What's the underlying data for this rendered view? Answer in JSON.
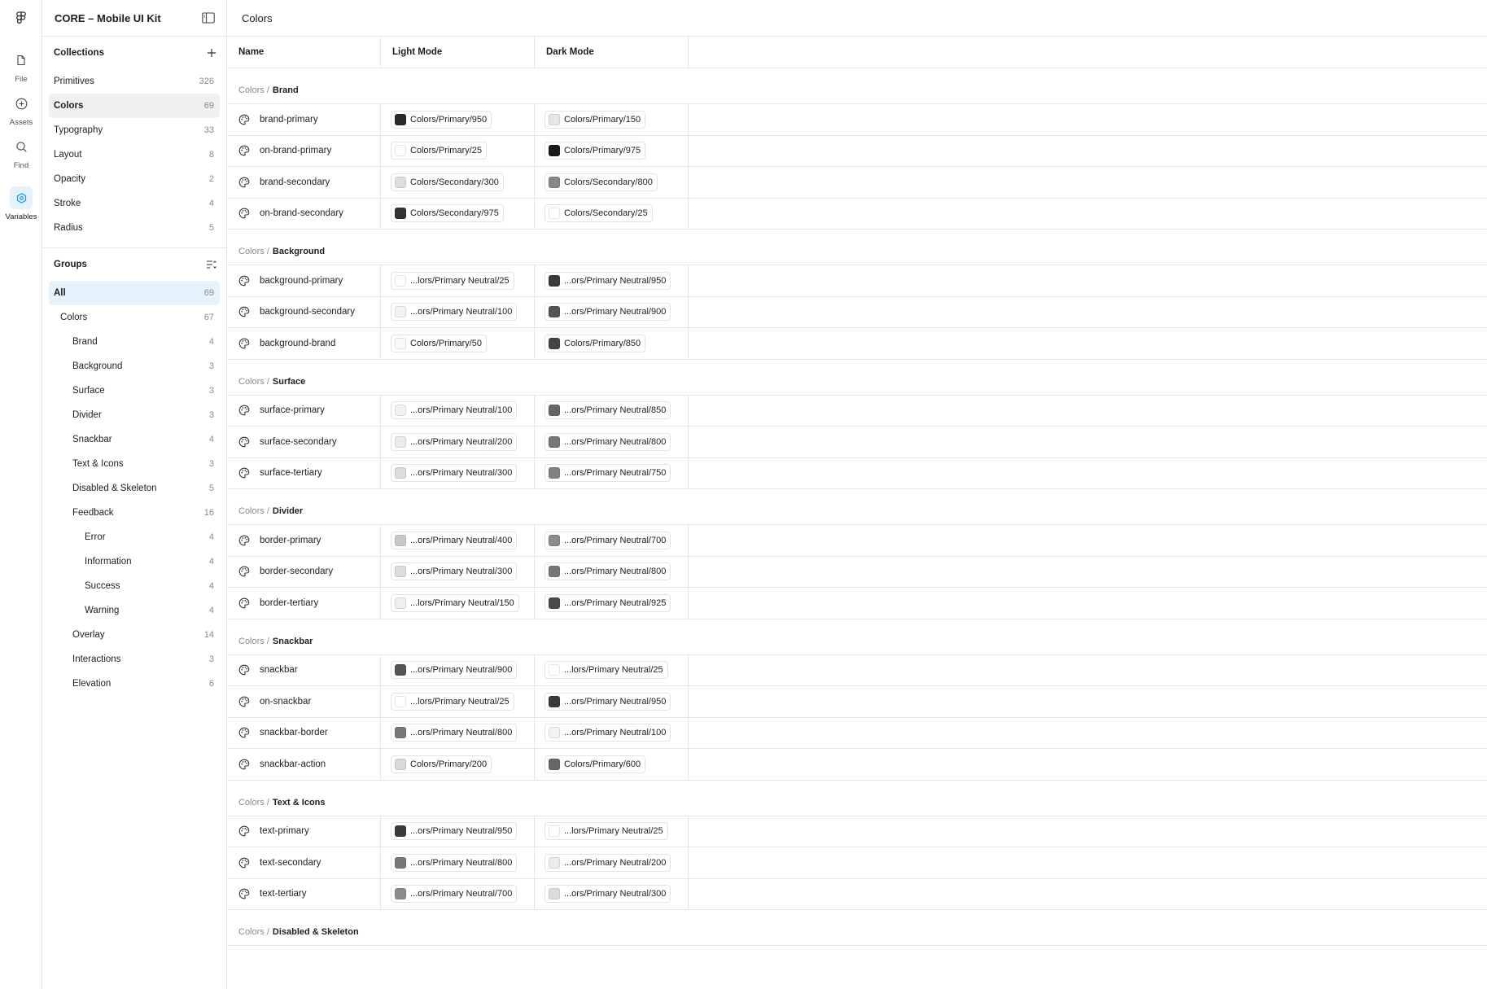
{
  "app": {
    "file_title": "CORE – Mobile UI Kit",
    "page_title": "Colors"
  },
  "rail": [
    {
      "label": "File",
      "icon": "file-icon"
    },
    {
      "label": "Assets",
      "icon": "plus-circle-icon"
    },
    {
      "label": "Find",
      "icon": "search-icon"
    },
    {
      "label": "Variables",
      "icon": "variables-icon"
    }
  ],
  "collections": {
    "title": "Collections",
    "items": [
      {
        "label": "Primitives",
        "count": "326"
      },
      {
        "label": "Colors",
        "count": "69"
      },
      {
        "label": "Typography",
        "count": "33"
      },
      {
        "label": "Layout",
        "count": "8"
      },
      {
        "label": "Opacity",
        "count": "2"
      },
      {
        "label": "Stroke",
        "count": "4"
      },
      {
        "label": "Radius",
        "count": "5"
      }
    ]
  },
  "groups": {
    "title": "Groups",
    "items": [
      {
        "label": "All",
        "count": "69"
      },
      {
        "label": "Colors",
        "count": "67"
      },
      {
        "label": "Brand",
        "count": "4"
      },
      {
        "label": "Background",
        "count": "3"
      },
      {
        "label": "Surface",
        "count": "3"
      },
      {
        "label": "Divider",
        "count": "3"
      },
      {
        "label": "Snackbar",
        "count": "4"
      },
      {
        "label": "Text & Icons",
        "count": "3"
      },
      {
        "label": "Disabled & Skeleton",
        "count": "5"
      },
      {
        "label": "Feedback",
        "count": "16"
      },
      {
        "label": "Error",
        "count": "4"
      },
      {
        "label": "Information",
        "count": "4"
      },
      {
        "label": "Success",
        "count": "4"
      },
      {
        "label": "Warning",
        "count": "4"
      },
      {
        "label": "Overlay",
        "count": "14"
      },
      {
        "label": "Interactions",
        "count": "3"
      },
      {
        "label": "Elevation",
        "count": "6"
      }
    ]
  },
  "table": {
    "headers": {
      "name": "Name",
      "light": "Light Mode",
      "dark": "Dark Mode"
    },
    "prefix": "Colors /",
    "sections": [
      {
        "group": "Brand",
        "rows": [
          {
            "name": "brand-primary",
            "light": "Colors/Primary/950",
            "light_color": "#2a2a2a",
            "dark": "Colors/Primary/150",
            "dark_color": "#e6e6e6"
          },
          {
            "name": "on-brand-primary",
            "light": "Colors/Primary/25",
            "light_color": "#ffffff",
            "dark": "Colors/Primary/975",
            "dark_color": "#1a1a1a"
          },
          {
            "name": "brand-secondary",
            "light": "Colors/Secondary/300",
            "light_color": "#dedede",
            "dark": "Colors/Secondary/800",
            "dark_color": "#888888"
          },
          {
            "name": "on-brand-secondary",
            "light": "Colors/Secondary/975",
            "light_color": "#333333",
            "dark": "Colors/Secondary/25",
            "dark_color": "#ffffff"
          }
        ]
      },
      {
        "group": "Background",
        "rows": [
          {
            "name": "background-primary",
            "light": "...lors/Primary Neutral/25",
            "light_color": "#ffffff",
            "dark": "...ors/Primary Neutral/950",
            "dark_color": "#3a3a3a"
          },
          {
            "name": "background-secondary",
            "light": "...ors/Primary Neutral/100",
            "light_color": "#f2f2f2",
            "dark": "...ors/Primary Neutral/900",
            "dark_color": "#555555"
          },
          {
            "name": "background-brand",
            "light": "Colors/Primary/50",
            "light_color": "#fafafa",
            "dark": "Colors/Primary/850",
            "dark_color": "#444444"
          }
        ]
      },
      {
        "group": "Surface",
        "rows": [
          {
            "name": "surface-primary",
            "light": "...ors/Primary Neutral/100",
            "light_color": "#f2f2f2",
            "dark": "...ors/Primary Neutral/850",
            "dark_color": "#666666"
          },
          {
            "name": "surface-secondary",
            "light": "...ors/Primary Neutral/200",
            "light_color": "#ebebeb",
            "dark": "...ors/Primary Neutral/800",
            "dark_color": "#777777"
          },
          {
            "name": "surface-tertiary",
            "light": "...ors/Primary Neutral/300",
            "light_color": "#dcdcdc",
            "dark": "...ors/Primary Neutral/750",
            "dark_color": "#828282"
          }
        ]
      },
      {
        "group": "Divider",
        "rows": [
          {
            "name": "border-primary",
            "light": "...ors/Primary Neutral/400",
            "light_color": "#c8c8c8",
            "dark": "...ors/Primary Neutral/700",
            "dark_color": "#8c8c8c"
          },
          {
            "name": "border-secondary",
            "light": "...ors/Primary Neutral/300",
            "light_color": "#dcdcdc",
            "dark": "...ors/Primary Neutral/800",
            "dark_color": "#777777"
          },
          {
            "name": "border-tertiary",
            "light": "...lors/Primary Neutral/150",
            "light_color": "#efefef",
            "dark": "...ors/Primary Neutral/925",
            "dark_color": "#4a4a4a"
          }
        ]
      },
      {
        "group": "Snackbar",
        "rows": [
          {
            "name": "snackbar",
            "light": "...ors/Primary Neutral/900",
            "light_color": "#555555",
            "dark": "...lors/Primary Neutral/25",
            "dark_color": "#ffffff"
          },
          {
            "name": "on-snackbar",
            "light": "...lors/Primary Neutral/25",
            "light_color": "#ffffff",
            "dark": "...ors/Primary Neutral/950",
            "dark_color": "#3a3a3a"
          },
          {
            "name": "snackbar-border",
            "light": "...ors/Primary Neutral/800",
            "light_color": "#777777",
            "dark": "...ors/Primary Neutral/100",
            "dark_color": "#f2f2f2"
          },
          {
            "name": "snackbar-action",
            "light": "Colors/Primary/200",
            "light_color": "#d9d9d9",
            "dark": "Colors/Primary/600",
            "dark_color": "#666666"
          }
        ]
      },
      {
        "group": "Text & Icons",
        "rows": [
          {
            "name": "text-primary",
            "light": "...ors/Primary Neutral/950",
            "light_color": "#3a3a3a",
            "dark": "...lors/Primary Neutral/25",
            "dark_color": "#ffffff"
          },
          {
            "name": "text-secondary",
            "light": "...ors/Primary Neutral/800",
            "light_color": "#777777",
            "dark": "...ors/Primary Neutral/200",
            "dark_color": "#ebebeb"
          },
          {
            "name": "text-tertiary",
            "light": "...ors/Primary Neutral/700",
            "light_color": "#8c8c8c",
            "dark": "...ors/Primary Neutral/300",
            "dark_color": "#dcdcdc"
          }
        ]
      },
      {
        "group": "Disabled & Skeleton",
        "rows": []
      }
    ]
  },
  "colors": {
    "selected_blue": "#e5f1fb",
    "accent": "#0d99ff"
  }
}
